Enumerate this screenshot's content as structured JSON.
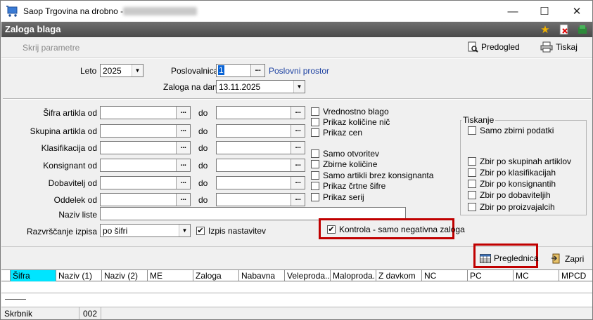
{
  "window": {
    "title": "Saop Trgovina na drobno - ",
    "minimize": "—",
    "maximize": "☐",
    "close": "✕"
  },
  "header": {
    "title": "Zaloga blaga"
  },
  "toolbar": {
    "hide_params": "Skrij parametre",
    "preview": "Predogled",
    "print": "Tiskaj"
  },
  "form": {
    "leto_label": "Leto",
    "leto_value": "2025",
    "poslovalnica_label": "Poslovalnica",
    "poslovalnica_value": "1",
    "poslovni_prostor": "Poslovni prostor",
    "zaloga_label": "Zaloga na dan",
    "zaloga_value": "13.11.2025",
    "do": "do",
    "ranges": [
      {
        "label": "Šifra artikla od"
      },
      {
        "label": "Skupina artikla od"
      },
      {
        "label": "Klasifikacija od"
      },
      {
        "label": "Konsignant od"
      },
      {
        "label": "Dobavitelj od"
      },
      {
        "label": "Oddelek od"
      }
    ],
    "naziv_label": "Naziv liste",
    "razvrscanje_label": "Razvrščanje izpisa",
    "razvrscanje_value": "po šifri",
    "izpis_nastavitev": "Izpis nastavitev",
    "checks_a": [
      "Vrednostno blago",
      "Prikaz količine nič",
      "Prikaz cen"
    ],
    "checks_b": [
      "Samo otvoritev",
      "Zbirne količine",
      "Samo artikli brez konsignanta",
      "Prikaz črtne šifre",
      "Prikaz serij"
    ],
    "kontrola": "Kontrola - samo negativna zaloga"
  },
  "tiskanje": {
    "title": "Tiskanje",
    "samo_zbirni": "Samo zbirni podatki",
    "zbir": [
      "Zbir po skupinah artiklov",
      "Zbir po klasifikacijah",
      "Zbir po konsignantih",
      "Zbir po dobaviteljih",
      "Zbir po proizvajalcih"
    ]
  },
  "actions": {
    "preglednica": "Preglednica",
    "zapri": "Zapri"
  },
  "grid": {
    "columns": [
      "Šifra",
      "Naziv (1)",
      "Naziv (2)",
      "ME",
      "Zaloga",
      "Nabavna",
      "Veleproda...",
      "Maloproda...",
      "Z davkom",
      "NC",
      "PC",
      "MC",
      "MPCD"
    ]
  },
  "status": {
    "user": "Skrbnik",
    "code": "002"
  },
  "colors": {
    "header_bg": "#5a5a5a",
    "highlight_red": "#c00000",
    "selected_col": "#00e5ff",
    "link": "#1a3fa0"
  }
}
